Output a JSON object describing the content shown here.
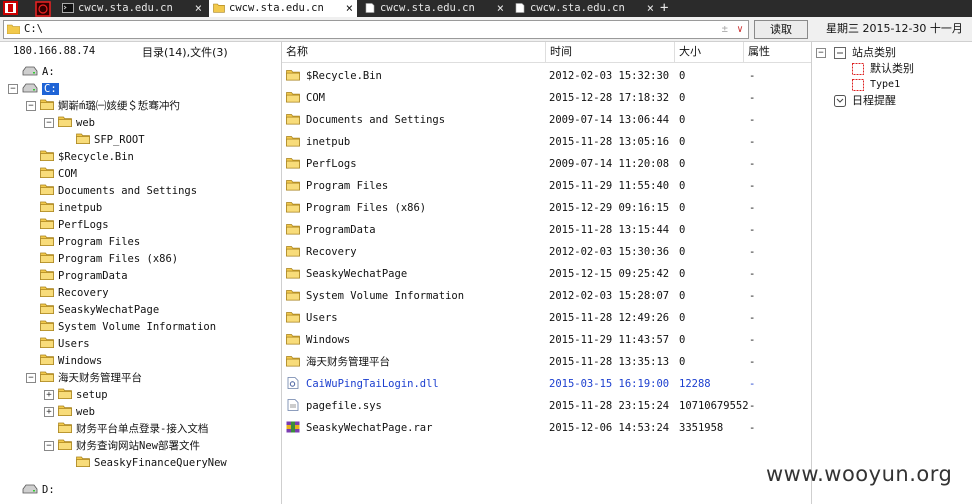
{
  "tabs": [
    {
      "label": "cwcw.sta.edu.cn",
      "active": false,
      "icon": "terminal-icon"
    },
    {
      "label": "cwcw.sta.edu.cn",
      "active": true,
      "icon": "folder-icon"
    },
    {
      "label": "cwcw.sta.edu.cn",
      "active": false,
      "icon": "document-icon"
    },
    {
      "label": "cwcw.sta.edu.cn",
      "active": false,
      "icon": "document-icon"
    }
  ],
  "address": {
    "path": "C:\\",
    "plus": "±",
    "dropdown": "∨",
    "read_button": "读取"
  },
  "datetime": "星期三 2015-12-30 十一月",
  "left": {
    "ip": "180.166.88.74",
    "counts": "目录(14),文件(3)"
  },
  "tree": [
    {
      "label": "A:",
      "type": "drive",
      "level": 0,
      "exp": ""
    },
    {
      "label": "C:",
      "type": "drive",
      "level": 0,
      "exp": "−",
      "selected": true
    },
    {
      "label": "婀嶄ḿ璐㈠姟绠＄悊骞冲彴",
      "type": "folder",
      "level": 1,
      "exp": "−"
    },
    {
      "label": "web",
      "type": "folder",
      "level": 2,
      "exp": "−"
    },
    {
      "label": "SFP_ROOT",
      "type": "folder",
      "level": 3,
      "exp": ""
    },
    {
      "label": "$Recycle.Bin",
      "type": "folder",
      "level": 1,
      "exp": ""
    },
    {
      "label": "COM",
      "type": "folder",
      "level": 1,
      "exp": ""
    },
    {
      "label": "Documents and Settings",
      "type": "folder",
      "level": 1,
      "exp": ""
    },
    {
      "label": "inetpub",
      "type": "folder",
      "level": 1,
      "exp": ""
    },
    {
      "label": "PerfLogs",
      "type": "folder",
      "level": 1,
      "exp": ""
    },
    {
      "label": "Program Files",
      "type": "folder",
      "level": 1,
      "exp": ""
    },
    {
      "label": "Program Files (x86)",
      "type": "folder",
      "level": 1,
      "exp": ""
    },
    {
      "label": "ProgramData",
      "type": "folder",
      "level": 1,
      "exp": ""
    },
    {
      "label": "Recovery",
      "type": "folder",
      "level": 1,
      "exp": ""
    },
    {
      "label": "SeaskyWechatPage",
      "type": "folder",
      "level": 1,
      "exp": ""
    },
    {
      "label": "System Volume Information",
      "type": "folder",
      "level": 1,
      "exp": ""
    },
    {
      "label": "Users",
      "type": "folder",
      "level": 1,
      "exp": ""
    },
    {
      "label": "Windows",
      "type": "folder",
      "level": 1,
      "exp": ""
    },
    {
      "label": "海天财务管理平台",
      "type": "folder",
      "level": 1,
      "exp": "−"
    },
    {
      "label": "setup",
      "type": "folder",
      "level": 2,
      "exp": "+"
    },
    {
      "label": "web",
      "type": "folder",
      "level": 2,
      "exp": "+"
    },
    {
      "label": "财务平台单点登录-接入文档",
      "type": "folder",
      "level": 2,
      "exp": ""
    },
    {
      "label": "财务查询网站New部署文件",
      "type": "folder",
      "level": 2,
      "exp": "−"
    },
    {
      "label": "SeaskyFinanceQueryNew",
      "type": "folder",
      "level": 3,
      "exp": ""
    },
    {
      "label": "D:",
      "type": "drive",
      "level": 0,
      "exp": "",
      "gap": true
    }
  ],
  "columns": {
    "name": "名称",
    "time": "时间",
    "size": "大小",
    "attr": "属性"
  },
  "files": [
    {
      "name": "$Recycle.Bin",
      "time": "2012-02-03 15:32:30",
      "size": "0",
      "attr": "-",
      "type": "folder"
    },
    {
      "name": "COM",
      "time": "2015-12-28 17:18:32",
      "size": "0",
      "attr": "-",
      "type": "folder"
    },
    {
      "name": "Documents and Settings",
      "time": "2009-07-14 13:06:44",
      "size": "0",
      "attr": "-",
      "type": "folder"
    },
    {
      "name": "inetpub",
      "time": "2015-11-28 13:05:16",
      "size": "0",
      "attr": "-",
      "type": "folder"
    },
    {
      "name": "PerfLogs",
      "time": "2009-07-14 11:20:08",
      "size": "0",
      "attr": "-",
      "type": "folder"
    },
    {
      "name": "Program Files",
      "time": "2015-11-29 11:55:40",
      "size": "0",
      "attr": "-",
      "type": "folder"
    },
    {
      "name": "Program Files (x86)",
      "time": "2015-12-29 09:16:15",
      "size": "0",
      "attr": "-",
      "type": "folder"
    },
    {
      "name": "ProgramData",
      "time": "2015-11-28 13:15:44",
      "size": "0",
      "attr": "-",
      "type": "folder"
    },
    {
      "name": "Recovery",
      "time": "2012-02-03 15:30:36",
      "size": "0",
      "attr": "-",
      "type": "folder"
    },
    {
      "name": "SeaskyWechatPage",
      "time": "2015-12-15 09:25:42",
      "size": "0",
      "attr": "-",
      "type": "folder"
    },
    {
      "name": "System Volume Information",
      "time": "2012-02-03 15:28:07",
      "size": "0",
      "attr": "-",
      "type": "folder"
    },
    {
      "name": "Users",
      "time": "2015-11-28 12:49:26",
      "size": "0",
      "attr": "-",
      "type": "folder"
    },
    {
      "name": "Windows",
      "time": "2015-11-29 11:43:57",
      "size": "0",
      "attr": "-",
      "type": "folder"
    },
    {
      "name": "海天财务管理平台",
      "time": "2015-11-28 13:35:13",
      "size": "0",
      "attr": "-",
      "type": "folder"
    },
    {
      "name": "CaiWuPingTaiLogin.dll",
      "time": "2015-03-15 16:19:00",
      "size": "12288",
      "attr": "-",
      "type": "dll",
      "highlight": true
    },
    {
      "name": "pagefile.sys",
      "time": "2015-11-28 23:15:24",
      "size": "10710679552",
      "attr": "-",
      "type": "file"
    },
    {
      "name": "SeaskyWechatPage.rar",
      "time": "2015-12-06 14:53:24",
      "size": "3351958",
      "attr": "-",
      "type": "rar"
    }
  ],
  "right": {
    "categories_label": "站点类别",
    "default_category": "默认类别",
    "type1": "Type1",
    "reminder": "日程提醒",
    "collapse_symbol": "−"
  },
  "watermark": "www.wooyun.org",
  "colors": {
    "tabbar": "#2b2b2b",
    "selection": "#1f64d6",
    "highlight_text": "#1c3fcf",
    "folder": "#f2c94c"
  }
}
